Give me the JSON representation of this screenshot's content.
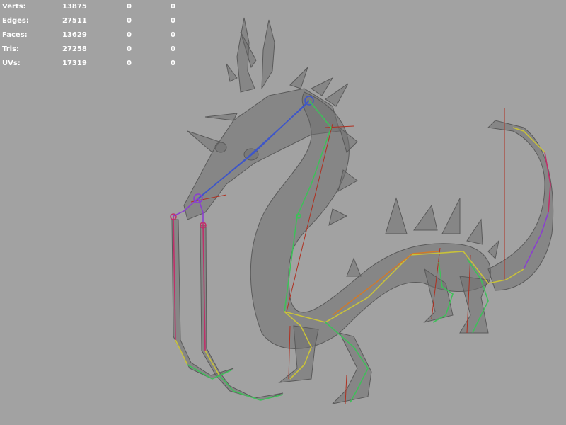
{
  "hud": {
    "rows": [
      {
        "label": "Verts:",
        "total": "13875",
        "selected": "0",
        "component": "0"
      },
      {
        "label": "Edges:",
        "total": "27511",
        "selected": "0",
        "component": "0"
      },
      {
        "label": "Faces:",
        "total": "13629",
        "selected": "0",
        "component": "0"
      },
      {
        "label": "Tris:",
        "total": "27258",
        "selected": "0",
        "component": "0"
      },
      {
        "label": "UVs:",
        "total": "17319",
        "selected": "0",
        "component": "0"
      }
    ]
  },
  "colors": {
    "background": "#a2a2a2",
    "mesh": "#6e6e6e",
    "joint_blue": "#3f57c8",
    "joint_green": "#3fbf5a",
    "joint_yellow": "#c9c23a",
    "joint_orange": "#d07a2a",
    "joint_magenta": "#c0306a",
    "joint_purple": "#8a3fd0",
    "locator_red": "#b03020"
  }
}
